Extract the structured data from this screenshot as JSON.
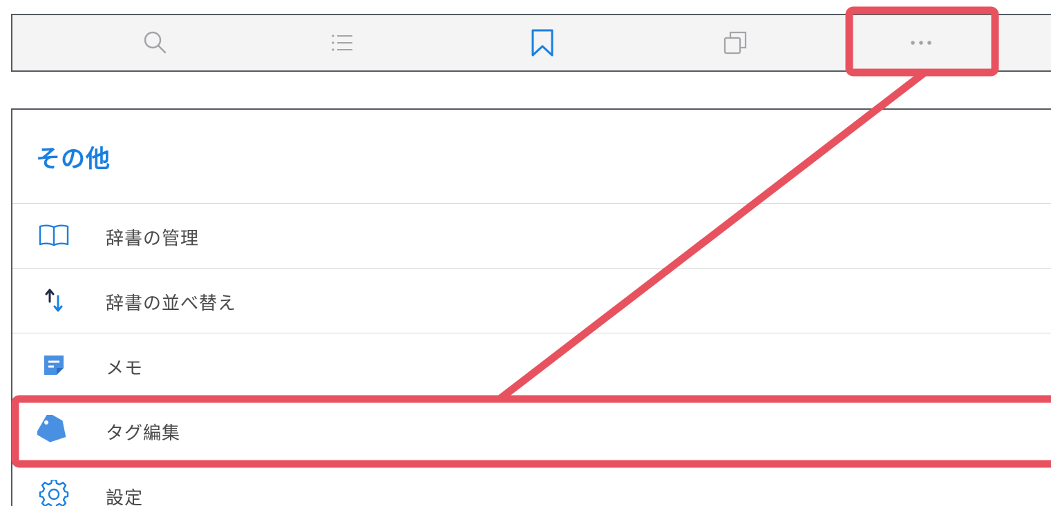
{
  "toolbar": {
    "buttons": [
      {
        "icon": "search-icon"
      },
      {
        "icon": "list-icon"
      },
      {
        "icon": "bookmark-icon"
      },
      {
        "icon": "copy-icon"
      },
      {
        "icon": "more-icon"
      }
    ],
    "active_color": "#1a7fe0",
    "inactive_color": "#a4a4a8"
  },
  "panel": {
    "title": "その他",
    "items": [
      {
        "label": "辞書の管理",
        "icon": "book-icon"
      },
      {
        "label": "辞書の並べ替え",
        "icon": "sort-arrows-icon"
      },
      {
        "label": "メモ",
        "icon": "memo-icon"
      },
      {
        "label": "タグ編集",
        "icon": "tag-icon"
      },
      {
        "label": "設定",
        "icon": "gear-icon"
      }
    ]
  },
  "highlight": {
    "color": "#e8525f"
  }
}
